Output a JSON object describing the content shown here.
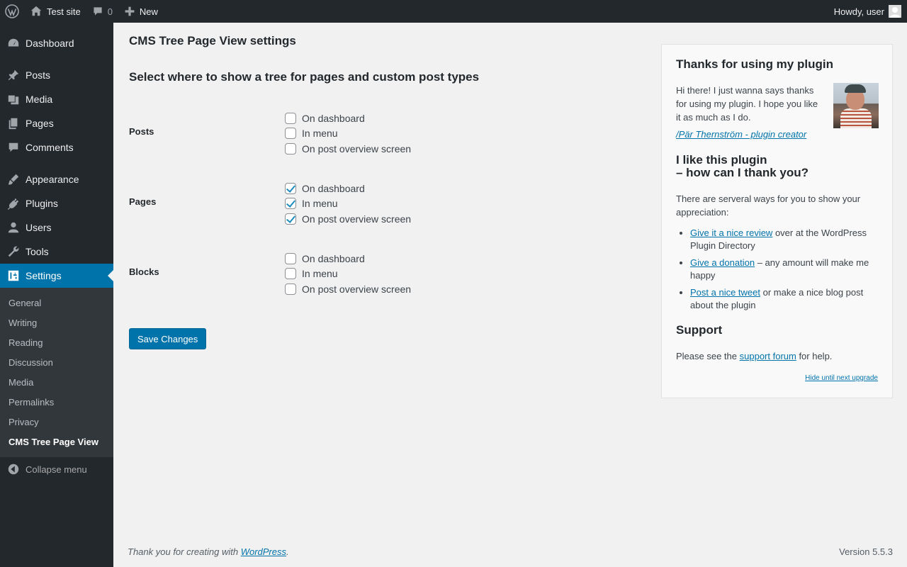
{
  "adminbar": {
    "site_name": "Test site",
    "comments_count": "0",
    "new_label": "New",
    "howdy": "Howdy, user"
  },
  "sidebar": {
    "items": [
      {
        "label": "Dashboard",
        "icon": "dashboard-icon"
      },
      {
        "label": "Posts",
        "icon": "pin-icon"
      },
      {
        "label": "Media",
        "icon": "media-icon"
      },
      {
        "label": "Pages",
        "icon": "pages-icon"
      },
      {
        "label": "Comments",
        "icon": "comment-icon"
      },
      {
        "label": "Appearance",
        "icon": "paintbrush-icon"
      },
      {
        "label": "Plugins",
        "icon": "plug-icon"
      },
      {
        "label": "Users",
        "icon": "user-icon"
      },
      {
        "label": "Tools",
        "icon": "wrench-icon"
      },
      {
        "label": "Settings",
        "icon": "settings-icon"
      }
    ],
    "submenu": [
      "General",
      "Writing",
      "Reading",
      "Discussion",
      "Media",
      "Permalinks",
      "Privacy",
      "CMS Tree Page View"
    ],
    "collapse": "Collapse menu"
  },
  "main": {
    "title": "CMS Tree Page View settings",
    "section_title": "Select where to show a tree for pages and custom post types",
    "option_labels": [
      "On dashboard",
      "In menu",
      "On post overview screen"
    ],
    "rows": [
      {
        "label": "Posts",
        "checked": [
          false,
          false,
          false
        ]
      },
      {
        "label": "Pages",
        "checked": [
          true,
          true,
          true
        ]
      },
      {
        "label": "Blocks",
        "checked": [
          false,
          false,
          false
        ]
      }
    ],
    "save_label": "Save Changes"
  },
  "plugin_box": {
    "thanks_title": "Thanks for using my plugin",
    "intro": "Hi there! I just wanna says thanks for using my plugin. I hope you like it as much as I do.",
    "creator_link": "/Pär Thernström - plugin creator",
    "like_title_1": "I like this plugin",
    "like_title_2": "– how can I thank you?",
    "ways": "There are serveral ways for you to show your appreciation:",
    "list": [
      {
        "link": "Give it a nice review",
        "rest": " over at the WordPress Plugin Directory"
      },
      {
        "link": "Give a donation",
        "rest": " – any amount will make me happy"
      },
      {
        "link": "Post a nice tweet",
        "rest": " or make a nice blog post about the plugin"
      }
    ],
    "support_title": "Support",
    "support_pre": "Please see the ",
    "support_link": "support forum",
    "support_post": " for help.",
    "hide_link": "Hide until next upgrade"
  },
  "footer": {
    "thanks_pre": "Thank you for creating with ",
    "thanks_link": "WordPress",
    "thanks_post": ".",
    "version": "Version 5.5.3"
  },
  "colors": {
    "adminbar_bg": "#23282d",
    "accent": "#0073aa",
    "submenu_bg": "#32373c",
    "page_bg": "#f1f1f1"
  }
}
